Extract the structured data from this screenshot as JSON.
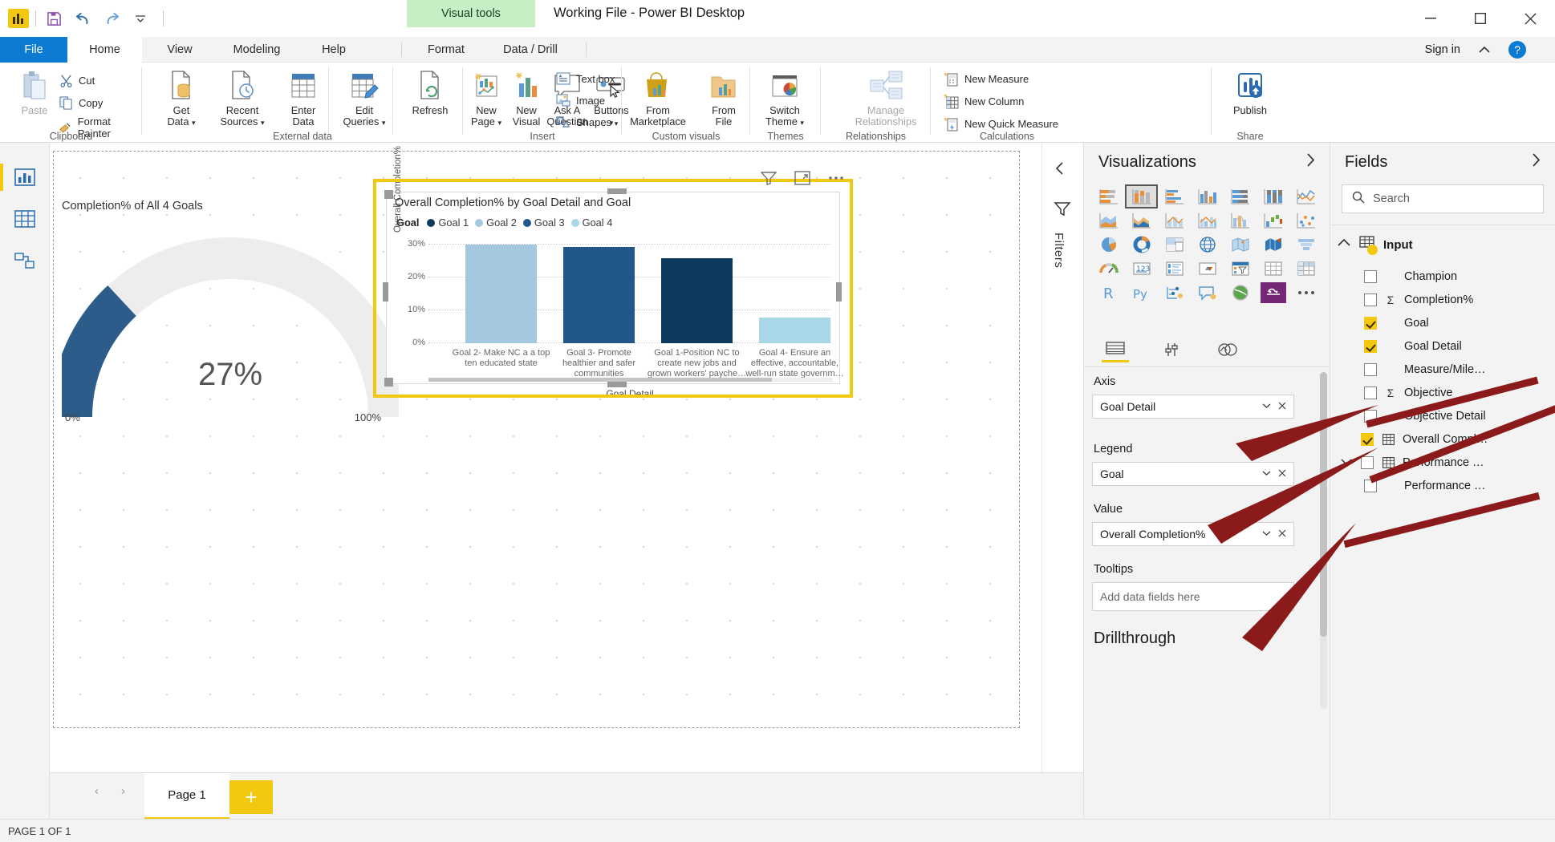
{
  "window": {
    "title": "Working File - Power BI Desktop",
    "contextual_tab_group": "Visual tools",
    "minimize": "—",
    "maximize": "☐",
    "close": "✕",
    "sign_in": "Sign in"
  },
  "quick_access": {
    "logo": "power-bi-logo",
    "save": "save-icon",
    "undo": "undo-icon",
    "redo": "redo-icon",
    "customize": "customize-qat-icon"
  },
  "ribbon": {
    "tabs": [
      {
        "label": "File",
        "state": "file"
      },
      {
        "label": "Home",
        "state": "selected"
      },
      {
        "label": "View",
        "state": "normal"
      },
      {
        "label": "Modeling",
        "state": "normal"
      },
      {
        "label": "Help",
        "state": "normal"
      },
      {
        "label": "Format",
        "state": "contextual"
      },
      {
        "label": "Data / Drill",
        "state": "contextual"
      }
    ],
    "groups": [
      {
        "name": "Clipboard",
        "big": [
          {
            "label": "Paste",
            "icon": "paste-icon",
            "disabled": true
          }
        ],
        "small": [
          {
            "label": "Cut",
            "icon": "cut-icon"
          },
          {
            "label": "Copy",
            "icon": "copy-icon"
          },
          {
            "label": "Format Painter",
            "icon": "format-painter-icon"
          }
        ]
      },
      {
        "name": "External data",
        "big": [
          {
            "label": "Get\nData",
            "icon": "get-data-icon",
            "caret": true
          },
          {
            "label": "Recent\nSources",
            "icon": "recent-sources-icon",
            "caret": true
          },
          {
            "label": "Enter\nData",
            "icon": "enter-data-icon"
          },
          {
            "label": "Edit\nQueries",
            "icon": "edit-queries-icon",
            "caret": true
          },
          {
            "label": "Refresh",
            "icon": "refresh-icon"
          }
        ]
      },
      {
        "name": "Insert",
        "big": [
          {
            "label": "New\nPage",
            "icon": "new-page-icon",
            "caret": true
          },
          {
            "label": "New\nVisual",
            "icon": "new-visual-icon"
          },
          {
            "label": "Ask A\nQuestion",
            "icon": "ask-question-icon"
          },
          {
            "label": "Buttons",
            "icon": "buttons-icon",
            "caret": true
          }
        ],
        "small": [
          {
            "label": "Text box",
            "icon": "text-box-icon"
          },
          {
            "label": "Image",
            "icon": "image-icon"
          },
          {
            "label": "Shapes",
            "icon": "shapes-icon",
            "caret": true
          }
        ]
      },
      {
        "name": "Custom visuals",
        "big": [
          {
            "label": "From\nMarketplace",
            "icon": "marketplace-icon"
          },
          {
            "label": "From\nFile",
            "icon": "from-file-icon"
          }
        ]
      },
      {
        "name": "Themes",
        "big": [
          {
            "label": "Switch\nTheme",
            "icon": "switch-theme-icon",
            "caret": true
          }
        ]
      },
      {
        "name": "Relationships",
        "big": [
          {
            "label": "Manage\nRelationships",
            "icon": "manage-relationships-icon",
            "disabled": true
          }
        ]
      },
      {
        "name": "Calculations",
        "small": [
          {
            "label": "New Measure",
            "icon": "new-measure-icon"
          },
          {
            "label": "New Column",
            "icon": "new-column-icon"
          },
          {
            "label": "New Quick Measure",
            "icon": "new-quick-measure-icon"
          }
        ]
      },
      {
        "name": "Share",
        "big": [
          {
            "label": "Publish",
            "icon": "publish-icon"
          }
        ]
      }
    ]
  },
  "left_rail": [
    {
      "name": "report-view",
      "icon": "report-chart-icon",
      "active": true
    },
    {
      "name": "data-view",
      "icon": "data-table-icon",
      "active": false
    },
    {
      "name": "model-view",
      "icon": "model-relationship-icon",
      "active": false
    }
  ],
  "canvas": {
    "gauge": {
      "title": "Completion% of All 4 Goals",
      "value_label": "27%",
      "min_label": "0%",
      "max_label": "100%",
      "value": 27,
      "arc_color": "#2B5C8A",
      "track_color": "#EDEDED"
    }
  },
  "chart_data": {
    "type": "bar",
    "title": "Overall Completion% by Goal Detail and Goal",
    "xlabel": "Goal Detail",
    "ylabel": "Overall Completion%",
    "ylim": [
      0,
      33
    ],
    "yticks": [
      "0%",
      "10%",
      "20%",
      "30%"
    ],
    "ytick_values": [
      0,
      10,
      20,
      30
    ],
    "grid": true,
    "legend_title": "Goal",
    "legend_position": "top",
    "legend": [
      {
        "name": "Goal 1",
        "color": "#0E3A5E"
      },
      {
        "name": "Goal 2",
        "color": "#A5C8E1"
      },
      {
        "name": "Goal 3",
        "color": "#21578B"
      },
      {
        "name": "Goal 4",
        "color": "#A8D8E8"
      }
    ],
    "categories": [
      "Goal 2- Make NC a a top ten educated state",
      "Goal 3- Promote healthier and safer communities",
      "Goal 1-Position NC to create new jobs and grown workers' payche…",
      "Goal 4- Ensure an effective, accountable, well-run state governm…"
    ],
    "series_of_bar": [
      "Goal 2",
      "Goal 3",
      "Goal 1",
      "Goal 4"
    ],
    "values": [
      31.5,
      30.5,
      27.0,
      8.0
    ],
    "colors": [
      "#A5C8E1",
      "#21578B",
      "#0E3A5E",
      "#A8D8E8"
    ]
  },
  "visual_header_icons": [
    {
      "name": "filter-icon"
    },
    {
      "name": "focus-mode-icon"
    },
    {
      "name": "more-options-icon"
    }
  ],
  "filters_strip": {
    "collapse": "‹",
    "icon": "filter-pane-icon",
    "label": "Filters"
  },
  "visualizations_pane": {
    "title": "Visualizations",
    "expand_icon": "chevron-right-icon",
    "icons": [
      "stacked-bar-chart",
      "stacked-column-chart",
      "clustered-bar-chart",
      "clustered-column-chart",
      "100-stacked-bar-chart",
      "100-stacked-column-chart",
      "line-chart",
      "area-chart",
      "stacked-area-chart",
      "line-stacked-column-chart",
      "line-clustered-column-chart",
      "ribbon-chart",
      "waterfall-chart",
      "scatter-chart",
      "pie-chart",
      "donut-chart",
      "treemap",
      "map",
      "filled-map",
      "shape-map",
      "funnel",
      "gauge",
      "card",
      "multi-row-card",
      "kpi",
      "slicer",
      "table",
      "matrix",
      "r-script-visual",
      "python-visual",
      "key-influencers",
      "qa-visual",
      "arcgis-maps",
      "power-apps",
      "get-more-visuals"
    ],
    "selected_icon_index": 1,
    "wells_tabs": [
      {
        "name": "fields-tab",
        "active": true
      },
      {
        "name": "format-tab",
        "active": false
      },
      {
        "name": "analytics-tab",
        "active": false
      }
    ],
    "wells": [
      {
        "label": "Axis",
        "value": "Goal Detail",
        "empty": false
      },
      {
        "label": "Legend",
        "value": "Goal",
        "empty": false
      },
      {
        "label": "Value",
        "value": "Overall Completion%",
        "empty": false
      },
      {
        "label": "Tooltips",
        "value": "Add data fields here",
        "empty": true
      }
    ],
    "well_caret": "⌄",
    "well_remove": "✕",
    "drillthrough": "Drillthrough"
  },
  "fields_pane": {
    "title": "Fields",
    "expand_icon": "chevron-right-icon",
    "search_placeholder": "Search",
    "search_value": "",
    "table": {
      "name": "Input",
      "icon": "table-icon",
      "expanded": true
    },
    "fields": [
      {
        "label": "Champion",
        "checked": false,
        "aggregate": false,
        "icon": "none"
      },
      {
        "label": "Completion%",
        "checked": false,
        "aggregate": true,
        "icon": "none"
      },
      {
        "label": "Goal",
        "checked": true,
        "aggregate": false,
        "icon": "none"
      },
      {
        "label": "Goal Detail",
        "checked": true,
        "aggregate": false,
        "icon": "none"
      },
      {
        "label": "Measure/Mile…",
        "checked": false,
        "aggregate": false,
        "icon": "none"
      },
      {
        "label": "Objective",
        "checked": false,
        "aggregate": true,
        "icon": "none"
      },
      {
        "label": "Objective Detail",
        "checked": false,
        "aggregate": false,
        "icon": "none"
      },
      {
        "label": "Overall Compl…",
        "checked": true,
        "aggregate": false,
        "icon": "table-icon"
      },
      {
        "label": "Performance …",
        "checked": false,
        "aggregate": false,
        "icon": "table-icon",
        "has_chevron": true
      },
      {
        "label": "Performance …",
        "checked": false,
        "aggregate": false,
        "icon": "none"
      }
    ]
  },
  "page_bar": {
    "prev": "‹",
    "next": "›",
    "tabs": [
      {
        "label": "Page 1",
        "active": true
      }
    ],
    "add_label": "+"
  },
  "status_bar": {
    "text": "PAGE 1 OF 1"
  },
  "annotations": {
    "arrow_color": "#8B1A1A",
    "arrows": 3
  }
}
